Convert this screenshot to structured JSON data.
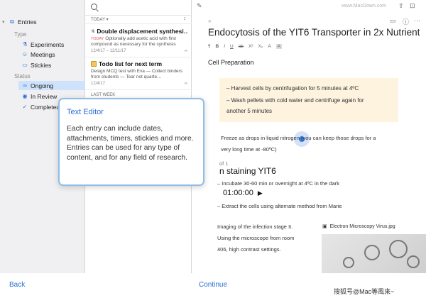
{
  "sidebar": {
    "entries_label": "Entries",
    "type_heading": "Type",
    "type_items": [
      "Experiments",
      "Meetings",
      "Stickies"
    ],
    "status_heading": "Status",
    "status_items": [
      "Ongoing",
      "In Review",
      "Completed"
    ]
  },
  "list": {
    "section_today": "TODAY ▾",
    "section_last_week": "LAST WEEK",
    "entries": [
      {
        "title": "Double displacement synthesi…",
        "tag": "TODAY",
        "body": "Optionally add acetic acid with first compound as necessary for the synthesis",
        "date": "12/4/17 – 12/11/17"
      },
      {
        "title": "Todo list for next term",
        "body": "Design MCQ test with Eva — Collect binders from students — Tear not quarte…",
        "date": "12/4/17"
      }
    ]
  },
  "editor": {
    "watermark": "www.MacDown.com",
    "title": "Endocytosis of the YIT6 Transporter in 2x Nutrient",
    "format_bar": [
      "¶",
      "B",
      "I",
      "U",
      "ab",
      "X²",
      "X₂",
      "A",
      "A"
    ],
    "section_heading": "Cell Preparation",
    "callout_lines": [
      "–  Harvest cells by centrifugation for 5 minutes at 4ºC",
      "–  Wash pellets with cold water and centrifuge again for",
      "    another 5 minutes"
    ],
    "freeze_line_1": "Freeze as drops in liquid nitrogen (you can keep those drops for a",
    "freeze_line_2": "very long time at -80ºC)",
    "part_label": "of 1",
    "staining_heading": "n staining YIT6",
    "incubate_line": "–  Incubate 30-60 min or overnight at 4ºC in the dark",
    "timer": "01:00:00",
    "extract_line": "–  Extract the cells using alternate method from Marie",
    "imaging_lines": [
      "Imaging of the infection stage II.",
      "Using the microscope from room",
      "406, high contrast settings."
    ],
    "image_label": "Electron Microscopy Virus.jpg"
  },
  "popup": {
    "title": "Text Editor",
    "body": "Each entry can include dates, attachments, timers, stickies and more. Entries can be used for any type of content, and for any field of research."
  },
  "bottom": {
    "back": "Back",
    "continue": "Continue"
  },
  "footer_mark": "搜狐号@Mac等風來~",
  "colors": {
    "accent": "#2a6fd6",
    "sidebar_bg": "#f0f0f2",
    "selection": "#cfe2fb",
    "callout_bg": "#fdf3df",
    "popup_border": "#8ebde9"
  }
}
